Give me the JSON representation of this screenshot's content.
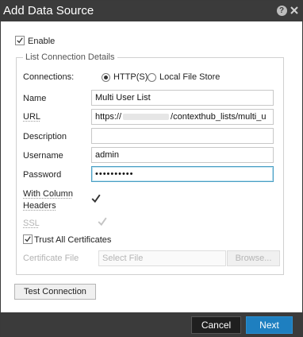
{
  "dialog": {
    "title": "Add Data Source"
  },
  "icons": {
    "help": "help-icon",
    "close": "close-icon",
    "check": "checkmark-icon"
  },
  "enable": {
    "label": "Enable",
    "checked": true
  },
  "fieldset": {
    "legend": "List Connection Details"
  },
  "connections": {
    "label": "Connections:",
    "options": [
      {
        "label": "HTTP(S)",
        "selected": true
      },
      {
        "label": "Local File Store",
        "selected": false
      }
    ]
  },
  "fields": {
    "name": {
      "label": "Name",
      "value": "Multi User List"
    },
    "url": {
      "label": "URL",
      "value_prefix": "https://",
      "value_suffix": "/contexthub_lists/multi_u"
    },
    "description": {
      "label": "Description",
      "value": ""
    },
    "username": {
      "label": "Username",
      "value": "admin"
    },
    "password": {
      "label": "Password",
      "value": "••••••••••"
    }
  },
  "with_column_headers": {
    "label_line1": "With Column",
    "label_line2": "Headers",
    "checked": true
  },
  "ssl": {
    "label": "SSL",
    "checked": true,
    "disabled": true
  },
  "trust_all": {
    "label": "Trust All Certificates",
    "checked": true
  },
  "certificate": {
    "label": "Certificate File",
    "placeholder": "Select File",
    "browse_label": "Browse..."
  },
  "buttons": {
    "test_connection": "Test Connection",
    "cancel": "Cancel",
    "next": "Next"
  },
  "colors": {
    "titlebar": "#3b3b3b",
    "primary": "#1e7fc0",
    "focus_border": "#4a9fc4"
  }
}
